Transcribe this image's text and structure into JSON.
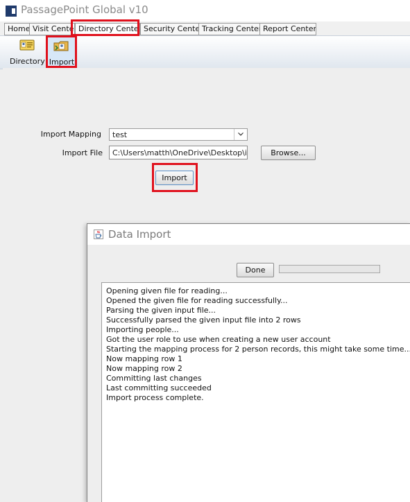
{
  "window": {
    "title": "PassagePoint Global v10"
  },
  "tabs": [
    {
      "label": "Home"
    },
    {
      "label": "Visit Center"
    },
    {
      "label": "Directory Center"
    },
    {
      "label": "Security Center"
    },
    {
      "label": "Tracking Center"
    },
    {
      "label": "Report Center"
    }
  ],
  "toolbar": {
    "buttons": [
      {
        "label": "Directory",
        "icon": "directory-card-icon"
      },
      {
        "label": "Import",
        "icon": "import-folder-icon"
      }
    ]
  },
  "form": {
    "import_mapping_label": "Import Mapping",
    "import_mapping_value": "test",
    "import_file_label": "Import File",
    "import_file_value": "C:\\Users\\matth\\OneDrive\\Desktop\\imnpor",
    "browse_label": "Browse...",
    "import_button_label": "Import"
  },
  "dialog": {
    "title": "Data Import",
    "done_label": "Done",
    "log_lines": [
      "Opening given file for reading...",
      "Opened the given file for reading successfully...",
      "Parsing the given input file...",
      "Successfully parsed the given input file into 2 rows",
      "Importing people...",
      "Got the user role to use when creating a new user account",
      "Starting the mapping process for 2 person records, this might take some time...",
      "Now mapping row 1",
      "Now mapping row 2",
      "Committing last changes",
      "Last committing succeeded",
      "Import process complete."
    ]
  },
  "colors": {
    "highlight": "#e0101c",
    "brand": "#1f3a6b"
  }
}
